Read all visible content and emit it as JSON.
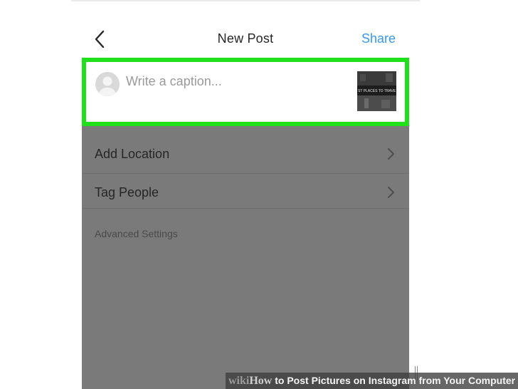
{
  "header": {
    "title": "New Post",
    "share_label": "Share",
    "back_icon": "chevron-left-icon"
  },
  "caption": {
    "placeholder": "Write a caption...",
    "value": "",
    "avatar_icon": "default-avatar-icon",
    "thumbnail_text": "ST PLACES TO TRAVE"
  },
  "options": {
    "items": [
      {
        "label": "Add Location",
        "icon": "chevron-right-icon"
      },
      {
        "label": "Tag People",
        "icon": "chevron-right-icon"
      }
    ],
    "advanced_label": "Advanced Settings"
  },
  "watermark": {
    "wiki": "wiki",
    "how": "How",
    "rest": " to Post Pictures on Instagram from Your Computer"
  },
  "colors": {
    "accent": "#3897f0",
    "highlight": "#1fe01a",
    "overlay": "#7a7a7a"
  }
}
